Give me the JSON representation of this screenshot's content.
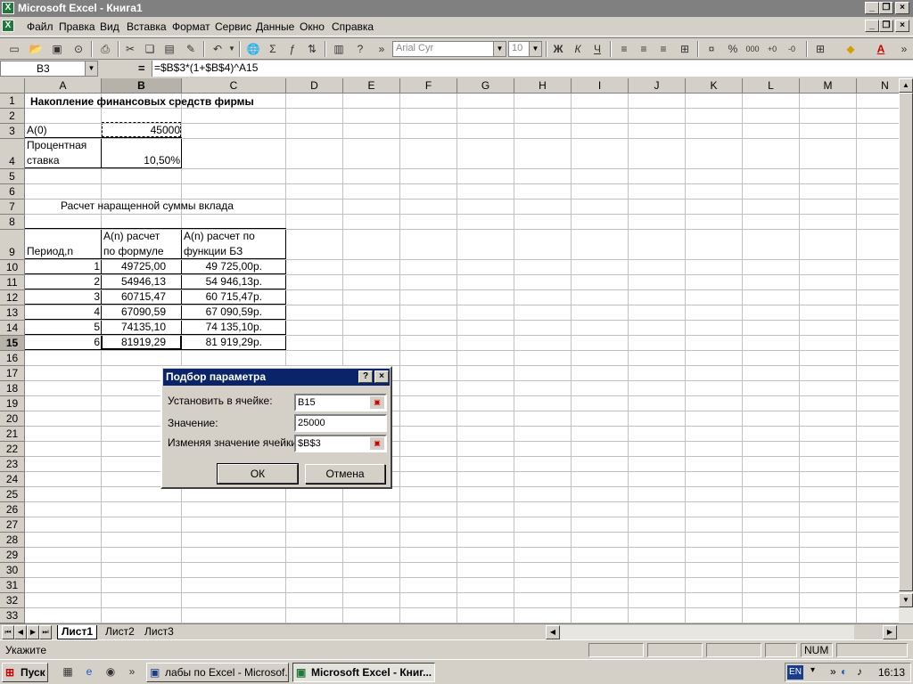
{
  "window": {
    "title": "Microsoft Excel - Книга1"
  },
  "menu": [
    "Файл",
    "Правка",
    "Вид",
    "Вставка",
    "Формат",
    "Сервис",
    "Данные",
    "Окно",
    "Справка"
  ],
  "toolbar": {
    "font": "Arial Cyr",
    "size": "10",
    "percent": "%",
    "thousands": "000",
    "sigma": "Σ",
    "bold": "Ж",
    "italic": "К",
    "underline": "Ч"
  },
  "formula_bar": {
    "name_box": "B3",
    "equals": "=",
    "formula": "=$B$3*(1+$B$4)^A15"
  },
  "columns": [
    "A",
    "B",
    "C",
    "D",
    "E",
    "F",
    "G",
    "H",
    "I",
    "J",
    "K",
    "L",
    "M",
    "N"
  ],
  "rows": [
    "1",
    "2",
    "3",
    "4",
    "5",
    "6",
    "7",
    "8",
    "9",
    "10",
    "11",
    "12",
    "13",
    "14",
    "15",
    "16",
    "17",
    "18",
    "19",
    "20",
    "21",
    "22",
    "23",
    "24",
    "25",
    "26",
    "27",
    "28",
    "29",
    "30",
    "31",
    "32",
    "33"
  ],
  "sheet": {
    "title": "Накопление финансовых средств фирмы",
    "a0_label": "А(0)",
    "a0_value": "45000",
    "rate_label_1": "Процентная",
    "rate_label_2": "ставка",
    "rate_value": "10,50%",
    "calc_title": "Расчет наращенной суммы вклада",
    "hdr_period": "Период,n",
    "hdr_formula_1": "А(n) расчет",
    "hdr_formula_2": "по формуле",
    "hdr_func_1": "А(n) расчет по",
    "hdr_func_2": "функции БЗ",
    "table": [
      {
        "n": "1",
        "formula": "49725,00",
        "func": "49 725,00р."
      },
      {
        "n": "2",
        "formula": "54946,13",
        "func": "54 946,13р."
      },
      {
        "n": "3",
        "formula": "60715,47",
        "func": "60 715,47р."
      },
      {
        "n": "4",
        "formula": "67090,59",
        "func": "67 090,59р."
      },
      {
        "n": "5",
        "formula": "74135,10",
        "func": "74 135,10р."
      },
      {
        "n": "6",
        "formula": "81919,29",
        "func": "81 919,29р."
      }
    ]
  },
  "dialog": {
    "title": "Подбор параметра",
    "help": "?",
    "close": "×",
    "set_cell_label": "Установить в ячейке:",
    "set_cell_value": "B15",
    "value_label": "Значение:",
    "value_value": "25000",
    "change_cell_label": "Изменяя значение ячейки:",
    "change_cell_value": "$B$3",
    "ok": "ОК",
    "cancel": "Отмена"
  },
  "tabs": [
    "Лист1",
    "Лист2",
    "Лист3"
  ],
  "status": {
    "mode": "Укажите",
    "num": "NUM"
  },
  "taskbar": {
    "start": "Пуск",
    "items": [
      "лабы по Excel - Microsof...",
      "Microsoft Excel - Книг..."
    ],
    "lang": "EN",
    "time": "16:13",
    "chevron": "»"
  }
}
